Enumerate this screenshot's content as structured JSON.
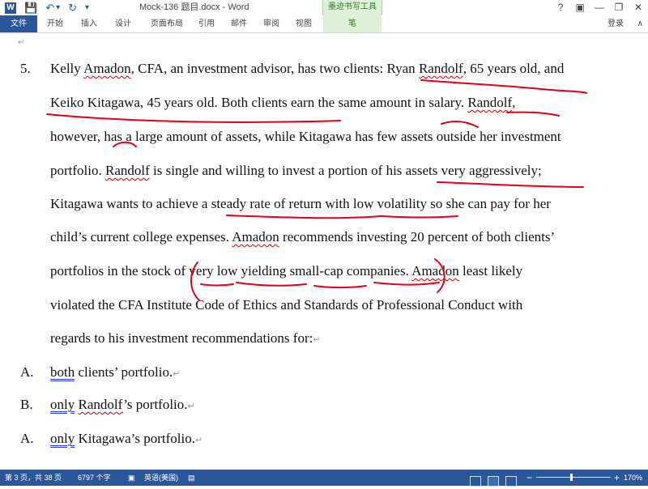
{
  "titlebar": {
    "title": "Mock-136 题目.docx - Word",
    "context_group": "墨迹书写工具",
    "help": "?",
    "minimize": "—",
    "restore": "❐",
    "close": "✕",
    "ribbon_display": "▣"
  },
  "qat": {
    "app_icon": "W",
    "save": "💾",
    "undo": "↶",
    "undo_drop": "▾",
    "redo": "↻",
    "customize": "▾"
  },
  "ribbon": {
    "tabs": [
      "文件",
      "开始",
      "插入",
      "设计",
      "页面布局",
      "引用",
      "邮件",
      "审阅",
      "视图",
      "笔"
    ],
    "signin": "登录",
    "collapse": "∧"
  },
  "doc": {
    "pilcrow": "↵",
    "qnum": "5.",
    "lines": [
      [
        "Kelly ",
        "Amadon",
        ", CFA, an investment advisor, has two clients: Ryan ",
        "Randolf",
        ", 65 years old, and"
      ],
      [
        "Keiko Kitagawa, 45 years old. Both clients earn the same amount in salary. ",
        "Randolf",
        ","
      ],
      [
        "however, has a large amount of assets, while Kitagawa has few assets outside her investment"
      ],
      [
        "portfolio. ",
        "Randolf",
        " is single and willing to invest a portion of his assets very aggressively;"
      ],
      [
        "Kitagawa wants to achieve a steady rate of return with low volatility so she can pay for her"
      ],
      [
        "child’s current college expenses. ",
        "Amadon",
        " recommends investing 20 percent of both clients’"
      ],
      [
        "portfolios in the stock of very low yielding small-cap companies. ",
        "Amadon",
        " least likely"
      ],
      [
        "violated the CFA Institute Code of Ethics and Standards of Professional Conduct with"
      ],
      [
        "regards to his investment recommendations for:"
      ]
    ],
    "options": [
      {
        "letter": "A.",
        "grammar": "both",
        "rest": " clients’ portfolio."
      },
      {
        "letter": "B.",
        "grammar": "only",
        "mid": " ",
        "spell": "Randolf",
        "rest": "’s portfolio."
      },
      {
        "letter": "A.",
        "grammar": "only",
        "rest": " Kitagawa’s portfolio."
      }
    ],
    "ink_color": "#e0001b"
  },
  "statusbar": {
    "page": "第 3 页，共 38 页",
    "words": "6797 个字",
    "proof_icon": "▣",
    "language": "英语(美国)",
    "macro_icon": "▤",
    "zoom_minus": "−",
    "zoom_plus": "+",
    "zoom": "170%"
  },
  "colors": {
    "accent": "#2b579a",
    "ink_tools": "#dff0d8",
    "spell": "#d00000",
    "grammar": "#2b3ec9"
  }
}
